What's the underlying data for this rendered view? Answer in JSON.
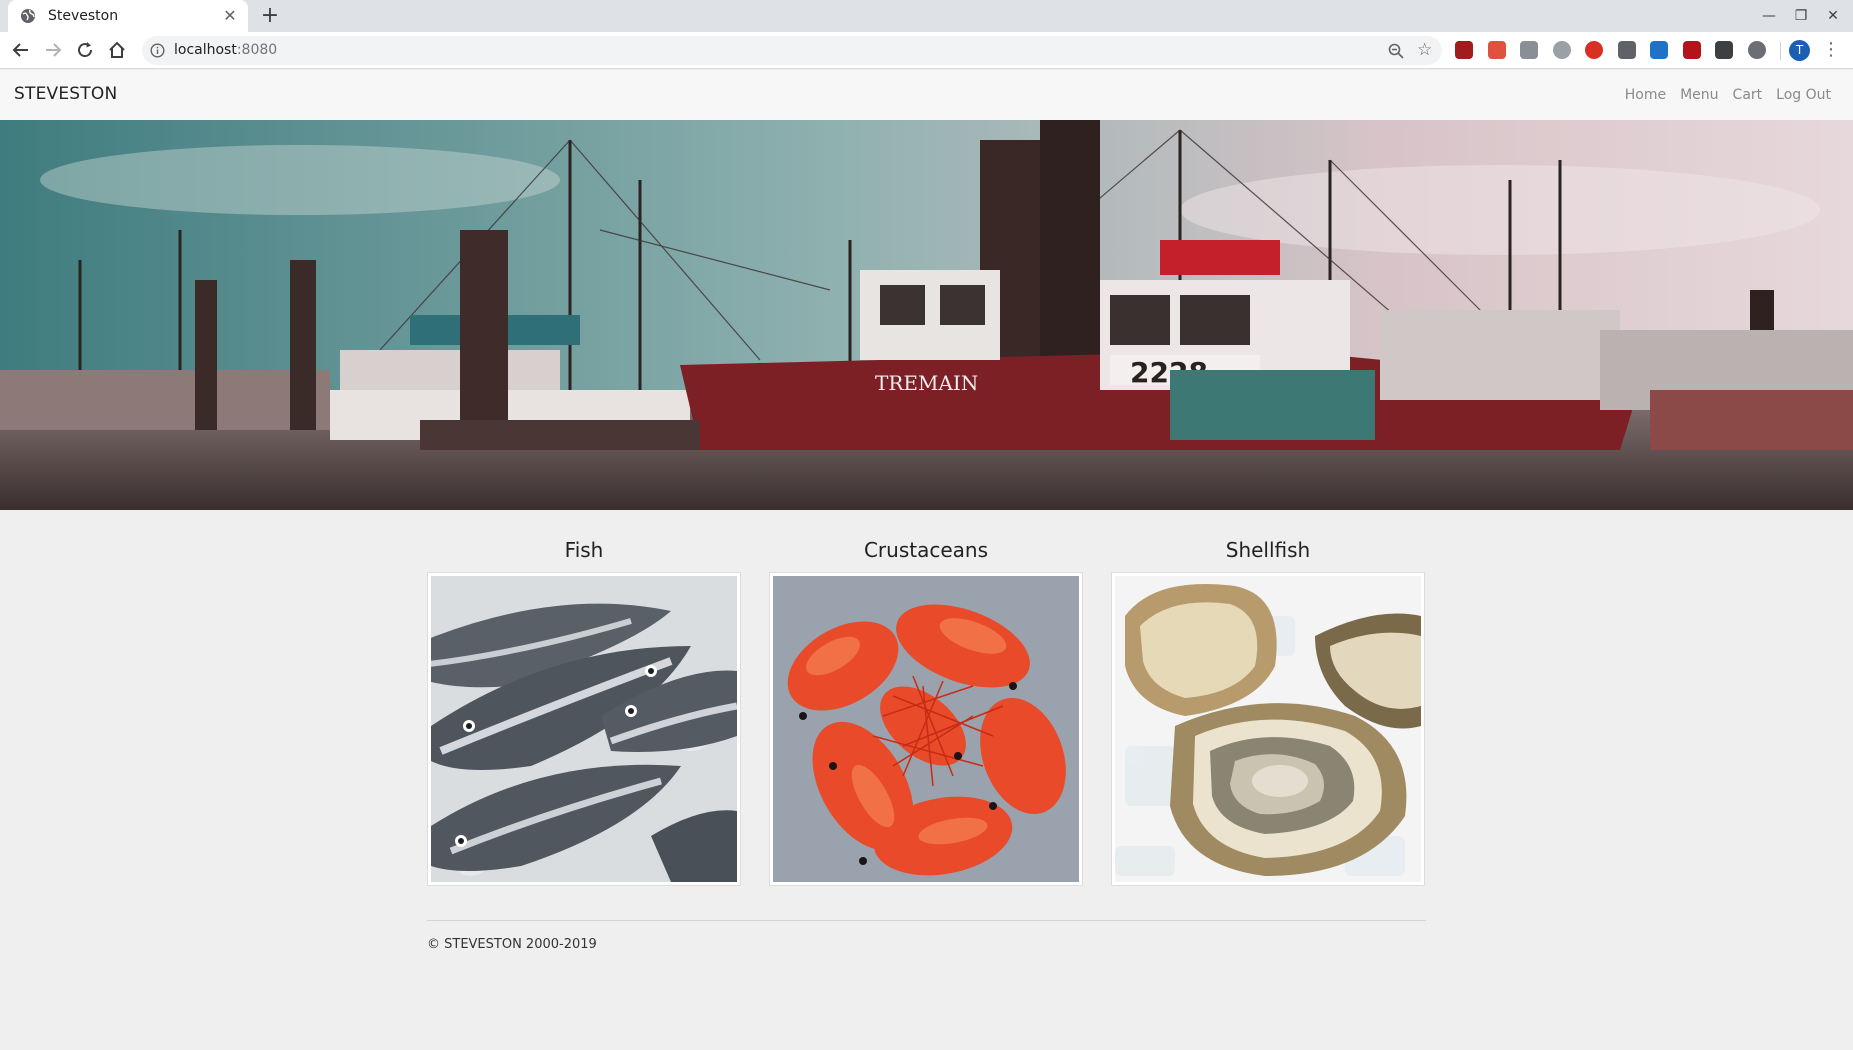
{
  "browser": {
    "tab_title": "Steveston",
    "url_host": "localhost",
    "url_port": ":8080",
    "avatar_initial": "T",
    "icons": [
      "globe-icon",
      "close-icon",
      "plus-icon",
      "back-icon",
      "forward-icon",
      "reload-icon",
      "home-icon",
      "info-icon",
      "zoom-icon",
      "star-icon",
      "menu-icon"
    ],
    "extensions": [
      {
        "name": "ublock-icon",
        "color": "#a11d1d"
      },
      {
        "name": "record-icon",
        "color": "#e0513f"
      },
      {
        "name": "monitor-icon",
        "color": "#8a8f96"
      },
      {
        "name": "m-icon",
        "color": "#9aa0a6"
      },
      {
        "name": "red-dot-icon",
        "color": "#d93025"
      },
      {
        "name": "pulse-icon",
        "color": "#5f6368"
      },
      {
        "name": "blue-square-icon",
        "color": "#1e73c9"
      },
      {
        "name": "shield-icon",
        "color": "#b3141c"
      },
      {
        "name": "incognito-icon",
        "color": "#3c4043"
      },
      {
        "name": "circle-icon",
        "color": "#6b6f75"
      }
    ]
  },
  "site": {
    "brand": "STEVESTON",
    "nav": [
      "Home",
      "Menu",
      "Cart",
      "Log Out"
    ],
    "hero_alt": "harbor-boats-image",
    "categories": [
      {
        "title": "Fish",
        "image": "salmon-on-ice-image"
      },
      {
        "title": "Crustaceans",
        "image": "spot-prawns-image"
      },
      {
        "title": "Shellfish",
        "image": "oysters-image"
      }
    ],
    "footer": "© STEVESTON 2000-2019"
  },
  "colors": {
    "page_background": "#efefef",
    "navbar_background": "#f7f7f7",
    "nav_link": "#8a8a8a",
    "tab_strip": "#dee1e6"
  }
}
